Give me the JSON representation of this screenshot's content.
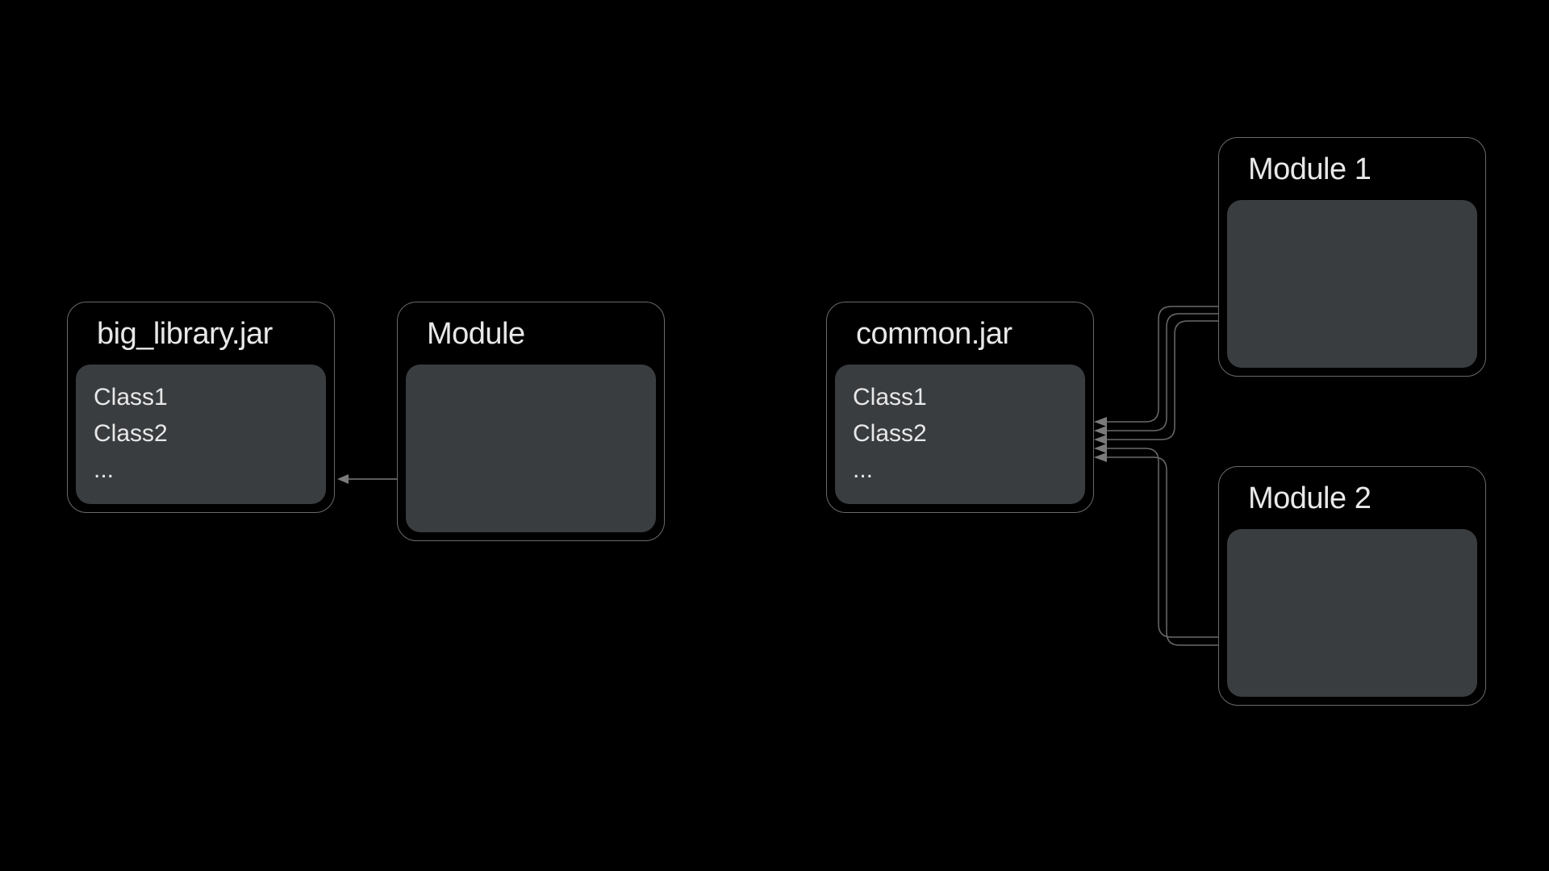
{
  "left": {
    "library": {
      "title": "big_library.jar",
      "classes": [
        "Class1",
        "Class2",
        "..."
      ]
    },
    "module": {
      "title": "Module"
    }
  },
  "right": {
    "library": {
      "title": "common.jar",
      "classes": [
        "Class1",
        "Class2",
        "..."
      ]
    },
    "module1": {
      "title": "Module 1"
    },
    "module2": {
      "title": "Module 2"
    }
  }
}
